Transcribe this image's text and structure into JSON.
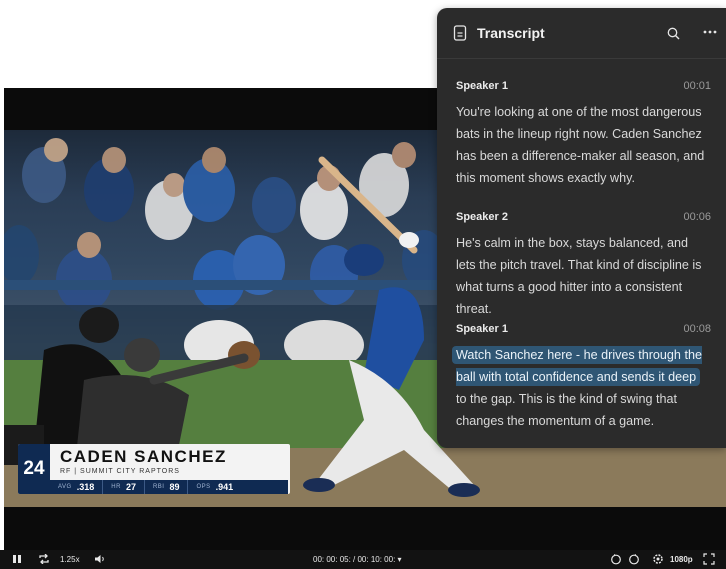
{
  "transcript": {
    "title": "Transcript",
    "segments": [
      {
        "speaker": "Speaker 1",
        "time": "00:01",
        "text": "You're looking at one of the most dangerous bats in the lineup right now. Caden Sanchez has been a difference-maker all season, and this moment shows exactly why."
      },
      {
        "speaker": "Speaker 2",
        "time": "00:06",
        "text": "He's calm in the box, stays balanced, and lets the pitch travel. That kind of discipline is what turns a good hitter into a consistent threat."
      },
      {
        "speaker": "Speaker 1",
        "time": "00:08",
        "highlight": "Watch Sanchez here - he drives through the ball with total confidence and sends it deep",
        "text_rest": " to the gap. This is the kind of swing that changes the momentum of a game."
      }
    ]
  },
  "player_graphic": {
    "number": "24",
    "name": "CADEN SANCHEZ",
    "subtitle": "RF | SUMMIT CITY RAPTORS",
    "stats": [
      {
        "label": "AVG",
        "value": ".318"
      },
      {
        "label": "HR",
        "value": "27"
      },
      {
        "label": "RBI",
        "value": "89"
      },
      {
        "label": "OPS",
        "value": ".941"
      }
    ]
  },
  "controls": {
    "speed": "1.25x",
    "time": "00: 00: 05: / 00: 10: 00: ▾",
    "quality": "1080p"
  },
  "colors": {
    "panel_bg": "#2b2b2b",
    "highlight": "#2f5674",
    "graphic_navy": "#0f2a52"
  },
  "icons": [
    "document-icon",
    "search-icon",
    "more-icon",
    "pause-icon",
    "loop-icon",
    "volume-icon",
    "rewind-icon",
    "forward-icon",
    "settings-icon",
    "fullscreen-icon"
  ]
}
